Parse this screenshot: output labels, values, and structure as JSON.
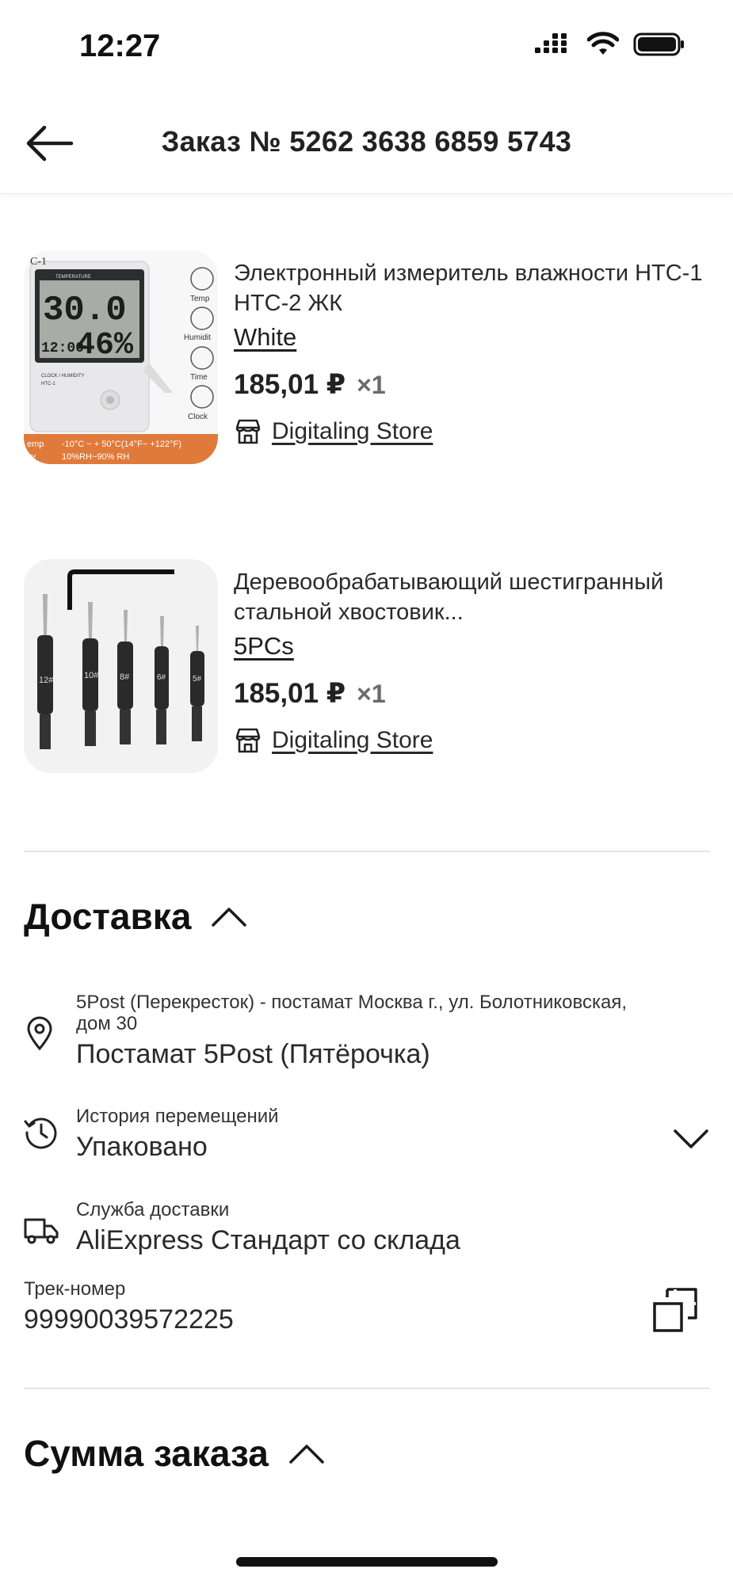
{
  "status": {
    "time": "12:27"
  },
  "header": {
    "title": "Заказ № 5262 3638 6859 5743"
  },
  "products": [
    {
      "title": "Электронный измеритель влажности HTC-1 HTC-2 ЖК",
      "variant": "White",
      "price": "185,01 ₽",
      "qty": "×1",
      "store": "Digitaling Store",
      "image": {
        "corner_label": "C-1",
        "lcd_top": "30.0",
        "lcd_bottom_small": "12:00",
        "lcd_bottom": "46%",
        "side_labels": [
          "Temp",
          "Humidit",
          "Time",
          "Clock"
        ],
        "brand_top": "TEMPERATURE",
        "brand_bottom": "CLOCK / HUMIDITY",
        "model": "HTC-1",
        "spec_line1_label": "emp",
        "spec_line1": "-10°C ~ + 50°C(14°F~ +122°F)",
        "spec_line2_label": "ity",
        "spec_line2": "10%RH~90% RH"
      }
    },
    {
      "title": "Деревообрабатывающий шестигранный стальной хвостовик...",
      "variant": "5PCs",
      "price": "185,01 ₽",
      "qty": "×1",
      "store": "Digitaling Store",
      "image": {
        "bit_labels": [
          "12#",
          "10#",
          "8#",
          "6#",
          "5#"
        ]
      }
    }
  ],
  "delivery": {
    "title": "Доставка",
    "address_detail": "5Post (Перекресток) - постамат Москва г., ул. Болотниковская, дом 30",
    "address_title": "Постамат 5Post (Пятёрочка)",
    "history_label": "История перемещений",
    "history_value": "Упаковано",
    "service_label": "Служба доставки",
    "service_value": "AliExpress Стандарт со склада",
    "track_label": "Трек-номер",
    "track_value": "99990039572225"
  },
  "summary": {
    "title": "Сумма заказа"
  },
  "icons": {
    "back": "arrow-left-icon",
    "store": "store-icon",
    "chevron_up": "chevron-up-icon",
    "chevron_down": "chevron-down-icon",
    "location": "location-pin-icon",
    "history": "history-icon",
    "truck": "truck-icon",
    "copy": "copy-icon"
  }
}
